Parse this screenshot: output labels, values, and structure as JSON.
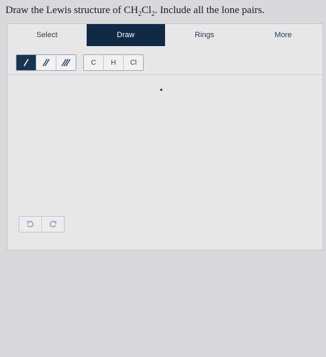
{
  "question": {
    "prefix": "Draw the Lewis structure of CH",
    "sub1": "2",
    "mid": "Cl",
    "sub2": "2",
    "suffix": ". Include all the lone pairs."
  },
  "tabs": [
    {
      "label": "Select",
      "active": false
    },
    {
      "label": "Draw",
      "active": true
    },
    {
      "label": "Rings",
      "active": false
    },
    {
      "label": "More",
      "active": false
    }
  ],
  "atoms": [
    "C",
    "H",
    "Cl"
  ],
  "colors": {
    "active_tab": "#102a45",
    "active_tool": "#163552",
    "toolbar_icon": "#2f4b68",
    "history_icon": "#8fa6bd"
  },
  "icons": {
    "single_bond": "single-bond-icon",
    "double_bond": "double-bond-icon",
    "triple_bond": "triple-bond-icon",
    "undo": "undo-icon",
    "redo": "redo-icon"
  }
}
